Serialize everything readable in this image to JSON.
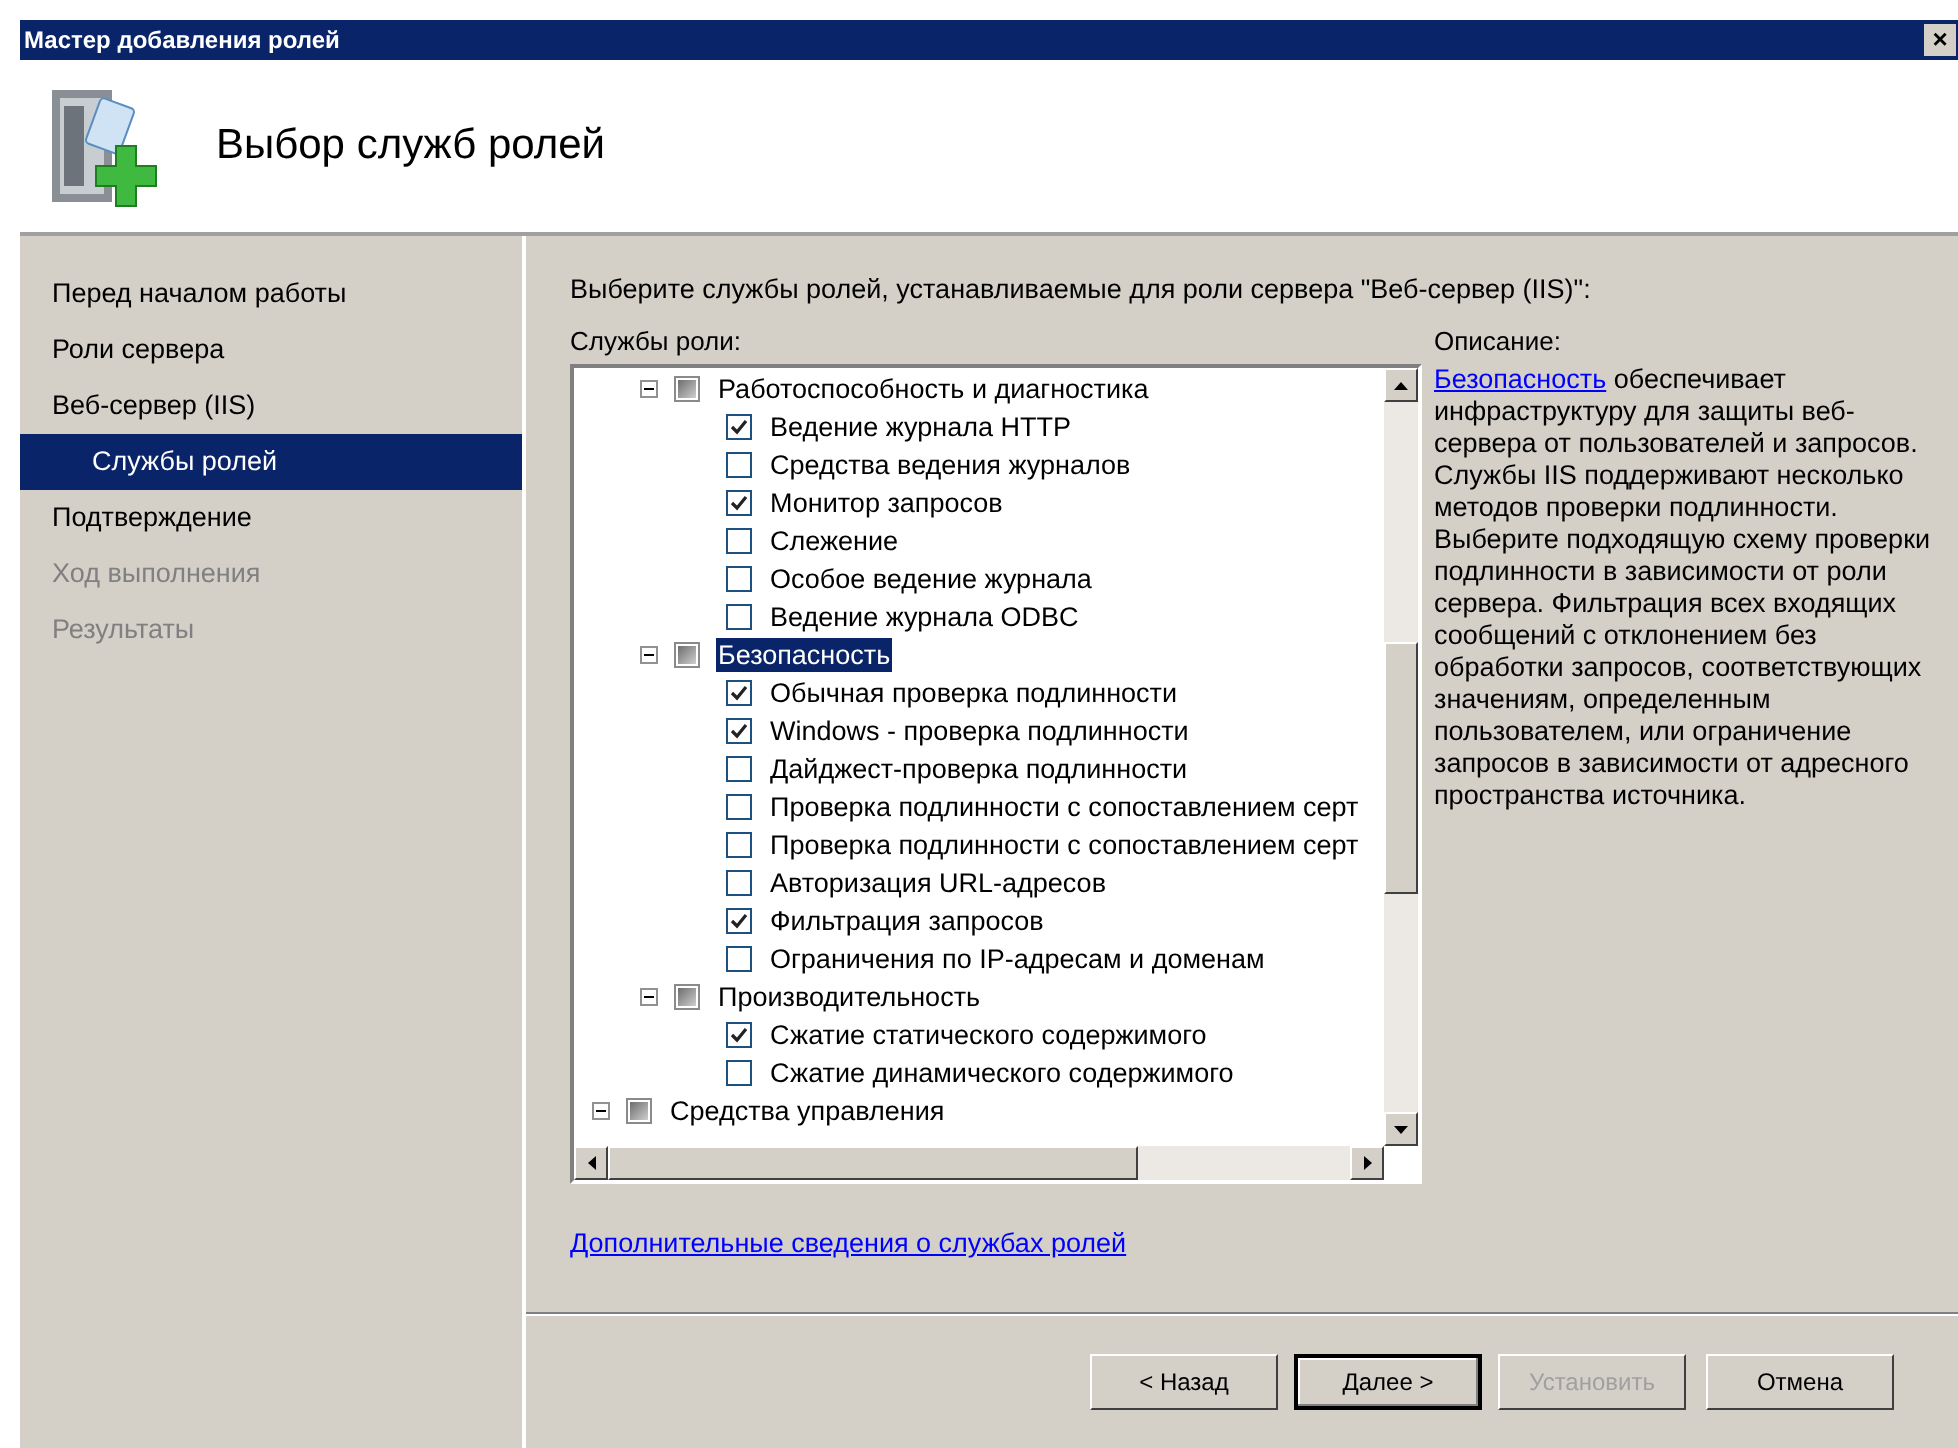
{
  "window": {
    "title": "Мастер добавления ролей",
    "close": "×"
  },
  "header": {
    "title": "Выбор служб ролей"
  },
  "sidebar": {
    "items": [
      {
        "label": "Перед началом работы",
        "selected": false,
        "disabled": false,
        "indented": false
      },
      {
        "label": "Роли сервера",
        "selected": false,
        "disabled": false,
        "indented": false
      },
      {
        "label": "Веб-сервер (IIS)",
        "selected": false,
        "disabled": false,
        "indented": false
      },
      {
        "label": "Службы ролей",
        "selected": true,
        "disabled": false,
        "indented": true
      },
      {
        "label": "Подтверждение",
        "selected": false,
        "disabled": false,
        "indented": false
      },
      {
        "label": "Ход выполнения",
        "selected": false,
        "disabled": true,
        "indented": false
      },
      {
        "label": "Результаты",
        "selected": false,
        "disabled": true,
        "indented": false
      }
    ]
  },
  "main": {
    "instruction": "Выберите службы ролей, устанавливаемые для роли сервера \"Веб-сервер (IIS)\":",
    "tree_label": "Службы роли:",
    "tree": {
      "items": [
        {
          "children": [
            {
              "label": "Работоспособность и диагностика",
              "expanded": true,
              "partial": true,
              "selected": false,
              "children": [
                {
                  "label": "Ведение журнала HTTP",
                  "checked": true
                },
                {
                  "label": "Средства ведения журналов",
                  "checked": false
                },
                {
                  "label": "Монитор запросов",
                  "checked": true
                },
                {
                  "label": "Слежение",
                  "checked": false
                },
                {
                  "label": "Особое ведение журнала",
                  "checked": false
                },
                {
                  "label": "Ведение журнала ODBC",
                  "checked": false
                }
              ]
            },
            {
              "label": "Безопасность",
              "expanded": true,
              "partial": true,
              "selected": true,
              "children": [
                {
                  "label": "Обычная проверка подлинности",
                  "checked": true
                },
                {
                  "label": "Windows - проверка подлинности",
                  "checked": true
                },
                {
                  "label": "Дайджест-проверка подлинности",
                  "checked": false
                },
                {
                  "label": "Проверка подлинности с сопоставлением серт",
                  "checked": false
                },
                {
                  "label": "Проверка подлинности с сопоставлением серт",
                  "checked": false
                },
                {
                  "label": "Авторизация URL-адресов",
                  "checked": false
                },
                {
                  "label": "Фильтрация запросов",
                  "checked": true
                },
                {
                  "label": "Ограничения по IP-адресам и доменам",
                  "checked": false
                }
              ]
            },
            {
              "label": "Производительность",
              "expanded": true,
              "partial": true,
              "selected": false,
              "children": [
                {
                  "label": "Сжатие статического содержимого",
                  "checked": true
                },
                {
                  "label": "Сжатие динамического содержимого",
                  "checked": false
                }
              ]
            }
          ]
        },
        {
          "label": "Средства управления",
          "expanded": true,
          "partial": true,
          "selected": false
        }
      ]
    },
    "more_link": "Дополнительные сведения о службах ролей",
    "description_label": "Описание:",
    "description_link": "Безопасность",
    "description": "обеспечивает инфраструктуру для защиты веб-сервера от пользователей и запросов. Службы IIS поддерживают несколько методов проверки подлинности. Выберите подходящую схему проверки подлинности в зависимости от роли сервера. Фильтрация всех входящих сообщений с отклонением без обработки запросов, соответствующих значениям, определенным пользователем, или ограничение запросов в зависимости от адресного пространства источника."
  },
  "buttons": [
    {
      "label": "< Назад",
      "default": false,
      "disabled": false
    },
    {
      "label": "Далее >",
      "default": true,
      "disabled": false
    },
    {
      "label": "Установить",
      "default": false,
      "disabled": true
    },
    {
      "label": "Отмена",
      "default": false,
      "disabled": false
    }
  ]
}
